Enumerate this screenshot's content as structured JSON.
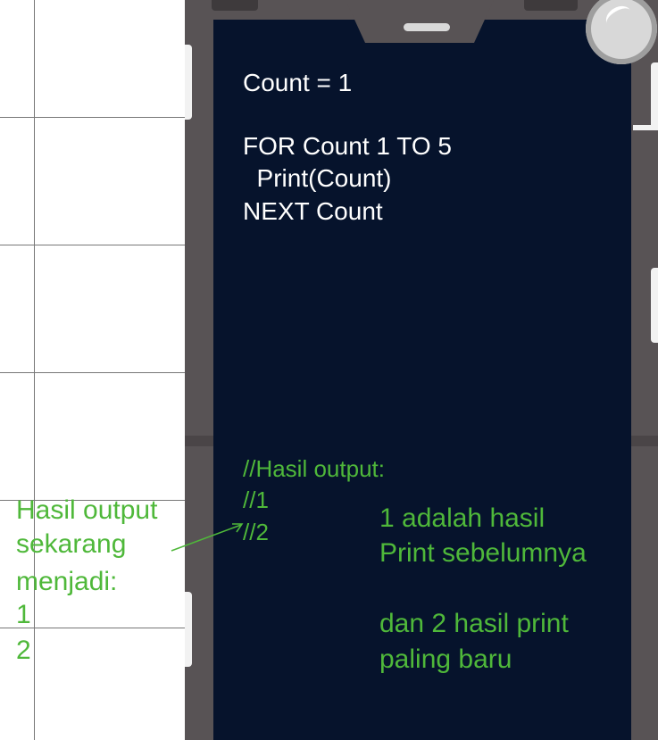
{
  "code": {
    "line1": "Count = 1",
    "line2": "FOR Count 1 TO 5",
    "line3": "  Print(Count)",
    "line4": "NEXT Count"
  },
  "output_comment": {
    "header": "//Hasil output:",
    "line1": "//1",
    "line2": "//2"
  },
  "note_right": {
    "line1": "1 adalah hasil",
    "line2": "Print sebelumnya",
    "line3": "dan 2 hasil print",
    "line4": "paling baru"
  },
  "note_left": {
    "line1": "Hasil output",
    "line2": "sekarang",
    "line3": "menjadi:",
    "line4": "1",
    "line5": "2"
  },
  "colors": {
    "screen": "#06132c",
    "frame": "#585355",
    "annotation": "#4fb83a",
    "code_text": "#ffffff"
  },
  "icons": {
    "camera": "camera-lens-icon",
    "speaker": "speaker-slot-icon"
  }
}
